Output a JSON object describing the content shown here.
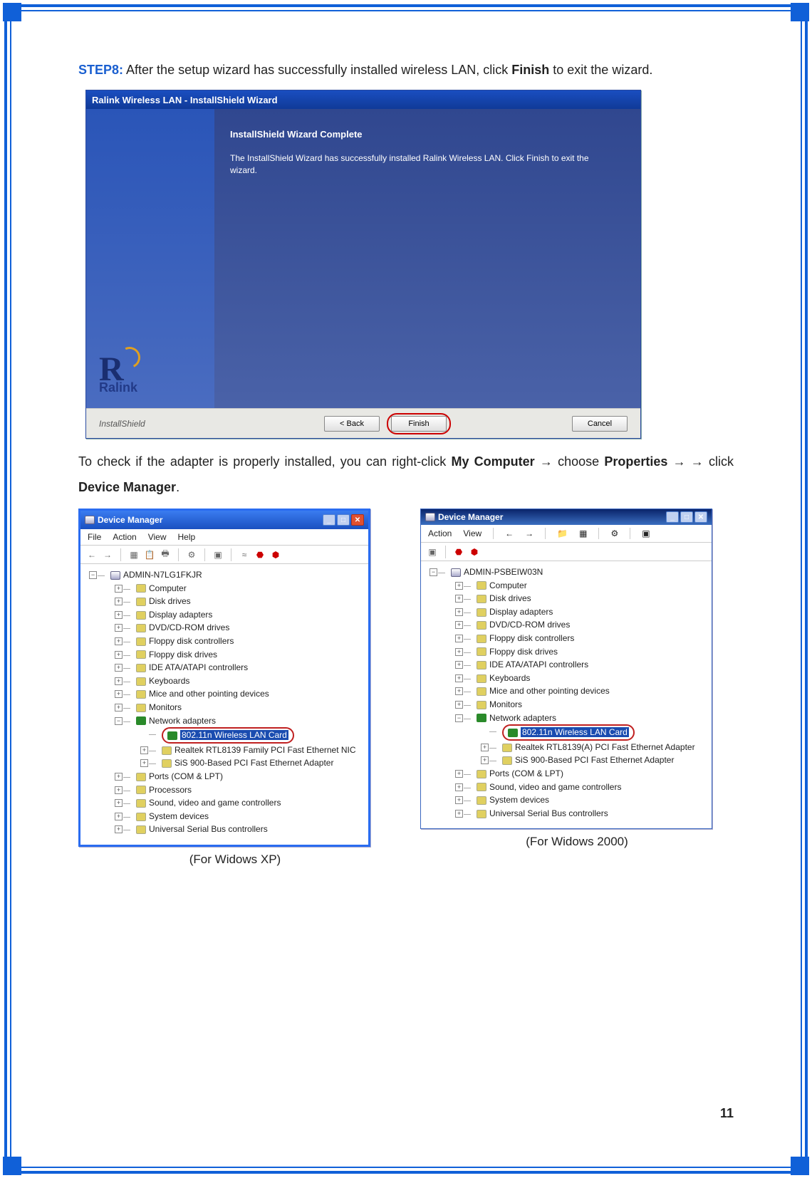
{
  "step_label": "STEP8:",
  "step_text_1": " After the setup wizard has successfully installed wireless LAN, click ",
  "step_bold_1": "Finish",
  "step_text_2": " to exit the wizard.",
  "wizard": {
    "title": "Ralink Wireless LAN - InstallShield Wizard",
    "heading": "InstallShield Wizard Complete",
    "message": "The InstallShield Wizard has successfully installed Ralink Wireless LAN.  Click Finish to exit the wizard.",
    "brand_big": "R",
    "brand_text": "Ralink",
    "footer_brand": "InstallShield",
    "btn_back": "< Back",
    "btn_finish": "Finish",
    "btn_cancel": "Cancel"
  },
  "para2_pre": "To check if the adapter is properly installed, you can right-click ",
  "para2_b1": "My Computer",
  "para2_arrow": " → ",
  "para2_mid1": "choose ",
  "para2_b2": "Properties",
  "para2_mid2": " → click ",
  "para2_b3": "Device Manager",
  "para2_end": ".",
  "dm_xp": {
    "title": "Device Manager",
    "menu": {
      "file": "File",
      "action": "Action",
      "view": "View",
      "help": "Help"
    },
    "root": "ADMIN-N7LG1FKJR",
    "items": [
      "Computer",
      "Disk drives",
      "Display adapters",
      "DVD/CD-ROM drives",
      "Floppy disk controllers",
      "Floppy disk drives",
      "IDE ATA/ATAPI controllers",
      "Keyboards",
      "Mice and other pointing devices",
      "Monitors"
    ],
    "netadapters_label": "Network adapters",
    "highlight": "802.11n Wireless LAN Card",
    "na_children": [
      "Realtek RTL8139 Family PCI Fast Ethernet NIC",
      "SiS 900-Based PCI Fast Ethernet Adapter"
    ],
    "after": [
      "Ports (COM & LPT)",
      "Processors",
      "Sound, video and game controllers",
      "System devices",
      "Universal Serial Bus controllers"
    ],
    "caption": "(For Widows XP)"
  },
  "dm_2k": {
    "title": "Device Manager",
    "menu": {
      "action": "Action",
      "view": "View"
    },
    "root": "ADMIN-PSBEIW03N",
    "items": [
      "Computer",
      "Disk drives",
      "Display adapters",
      "DVD/CD-ROM drives",
      "Floppy disk controllers",
      "Floppy disk drives",
      "IDE ATA/ATAPI controllers",
      "Keyboards",
      "Mice and other pointing devices",
      "Monitors"
    ],
    "netadapters_label": "Network adapters",
    "highlight": "802.11n Wireless LAN Card",
    "na_children": [
      "Realtek RTL8139(A) PCI Fast Ethernet Adapter",
      "SiS 900-Based PCI Fast Ethernet Adapter"
    ],
    "after": [
      "Ports (COM & LPT)",
      "Sound, video and game controllers",
      "System devices",
      "Universal Serial Bus controllers"
    ],
    "caption": "(For Widows 2000)"
  },
  "page_number": "11"
}
